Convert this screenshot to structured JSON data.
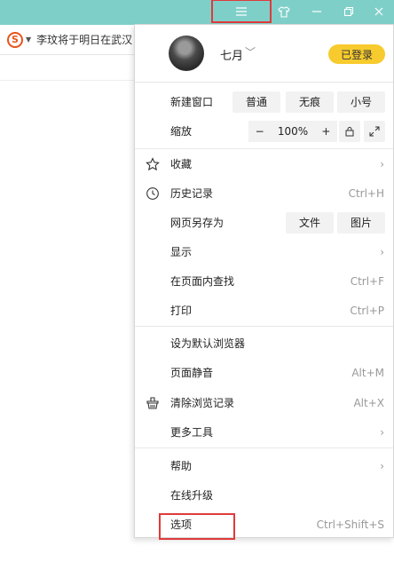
{
  "titlebar": {
    "menu_icon": "menu-icon",
    "skin_icon": "skin-icon",
    "min_icon": "minimize-icon",
    "restore_icon": "restore-icon",
    "close_icon": "close-icon"
  },
  "addressbar": {
    "engine_logo": "S",
    "text": "李玟将于明日在武汉"
  },
  "profile": {
    "username": "七月",
    "login_label": "已登录"
  },
  "new_window": {
    "label": "新建窗口",
    "normal": "普通",
    "incognito": "无痕",
    "small": "小号"
  },
  "zoom": {
    "label": "缩放",
    "minus": "−",
    "value": "100%",
    "plus": "+"
  },
  "items_group1": [
    {
      "label": "收藏",
      "icon": "star-icon",
      "shortcut": "",
      "chevron": true
    },
    {
      "label": "历史记录",
      "icon": "clock-icon",
      "shortcut": "Ctrl+H",
      "chevron": false
    },
    {
      "label": "网页另存为",
      "icon": "",
      "shortcut": "",
      "chevron": false
    },
    {
      "label": "显示",
      "icon": "",
      "shortcut": "",
      "chevron": true
    },
    {
      "label": "在页面内查找",
      "icon": "",
      "shortcut": "Ctrl+F",
      "chevron": false
    },
    {
      "label": "打印",
      "icon": "",
      "shortcut": "Ctrl+P",
      "chevron": false
    }
  ],
  "saveas": {
    "file": "文件",
    "image": "图片"
  },
  "items_group2": [
    {
      "label": "设为默认浏览器",
      "shortcut": ""
    },
    {
      "label": "页面静音",
      "shortcut": "Alt+M"
    },
    {
      "label": "清除浏览记录",
      "shortcut": "Alt+X"
    },
    {
      "label": "更多工具",
      "shortcut": ""
    }
  ],
  "items_group3": [
    {
      "label": "帮助",
      "shortcut": ""
    },
    {
      "label": "在线升级",
      "shortcut": ""
    },
    {
      "label": "选项",
      "shortcut": "Ctrl+Shift+S"
    }
  ],
  "colors": {
    "titlebar": "#7fcfc9",
    "login": "#f7cb2d",
    "highlight": "#e03a3a"
  }
}
